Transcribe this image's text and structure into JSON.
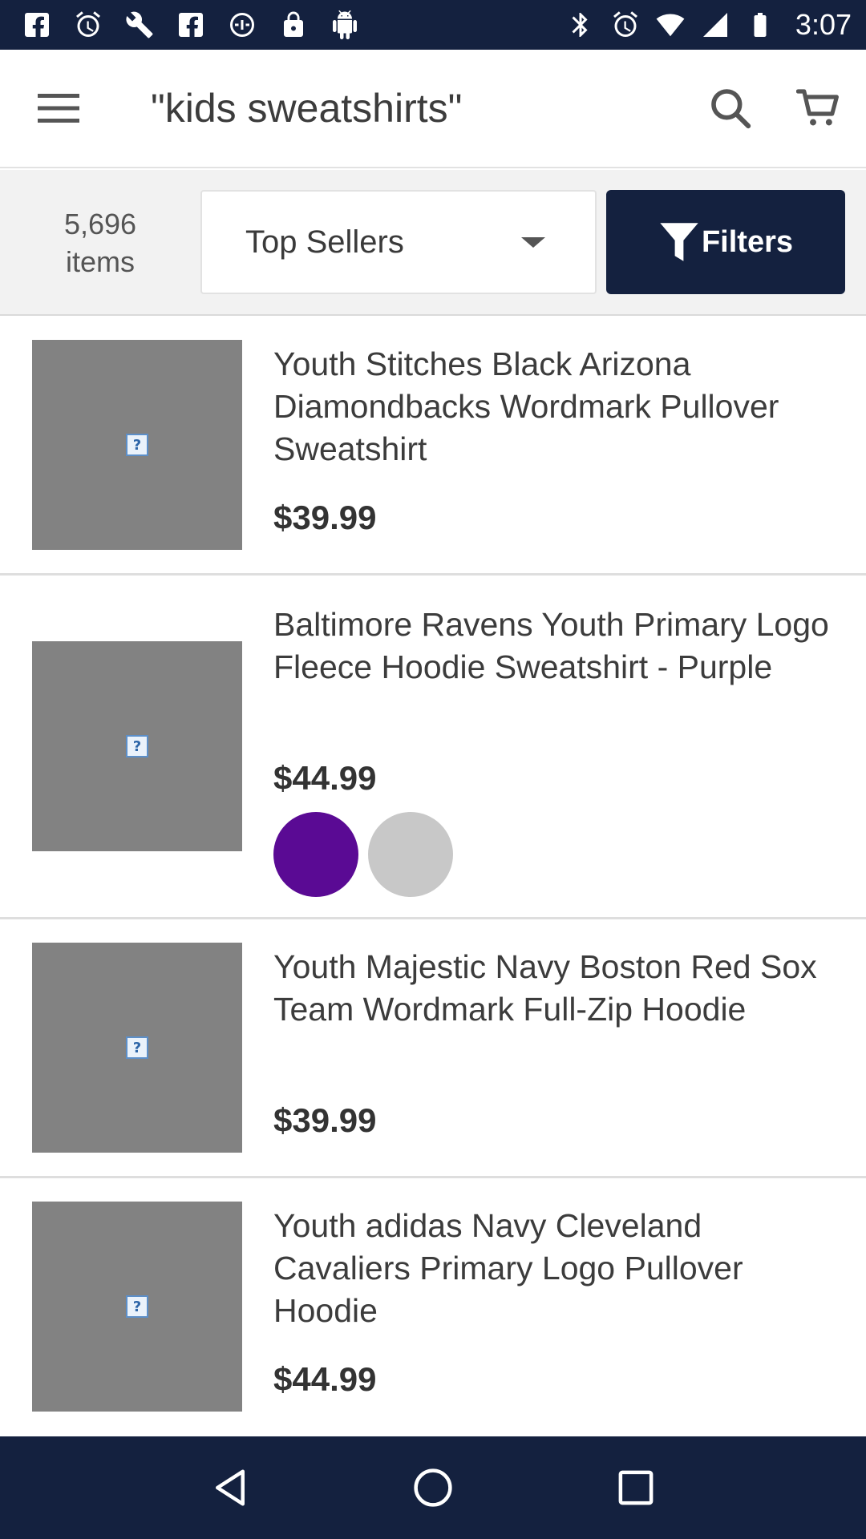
{
  "status_bar": {
    "time": "3:07",
    "left_icons": [
      "facebook-icon",
      "alarm-icon",
      "wrench-icon",
      "facebook-icon",
      "cast-icon",
      "lock-icon",
      "android-icon"
    ],
    "right_icons": [
      "bluetooth-icon",
      "alarm-icon",
      "wifi-icon",
      "signal-icon",
      "battery-icon"
    ]
  },
  "header": {
    "title": "\"kids sweatshirts\"",
    "menu_icon": "hamburger-menu-icon",
    "search_icon": "search-icon",
    "cart_icon": "cart-icon"
  },
  "toolbar": {
    "item_count_line1": "5,696",
    "item_count_line2": "items",
    "sort_value": "Top Sellers",
    "filters_label": "Filters"
  },
  "products": [
    {
      "title": "Youth Stitches Black Arizona Diamondbacks Wordmark Pullover Sweatshirt",
      "price": "$39.99",
      "swatches": []
    },
    {
      "title": "Baltimore Ravens Youth Primary Logo Fleece Hoodie Sweatshirt - Purple",
      "price": "$44.99",
      "swatches": [
        "#5a0a94",
        "#c8c8c8"
      ]
    },
    {
      "title": "Youth Majestic Navy Boston Red Sox Team Wordmark Full-Zip Hoodie",
      "price": "$39.99",
      "swatches": []
    },
    {
      "title": "Youth adidas Navy Cleveland Cavaliers Primary Logo Pullover Hoodie",
      "price": "$44.99",
      "swatches": []
    }
  ],
  "colors": {
    "brand_navy": "#14213f",
    "placeholder_gray": "#828282",
    "swatch_purple": "#5a0a94",
    "swatch_gray": "#c8c8c8"
  },
  "nav_bar": {
    "icons": [
      "back-icon",
      "home-icon",
      "recents-icon"
    ]
  }
}
